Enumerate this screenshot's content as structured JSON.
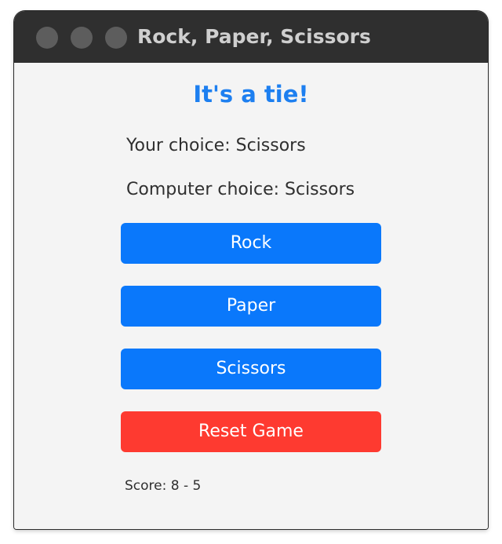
{
  "window": {
    "title": "Rock, Paper, Scissors"
  },
  "game": {
    "result": "It's a tie!",
    "your_choice": "Your choice: Scissors",
    "computer_choice": "Computer choice: Scissors",
    "score": "Score: 8 - 5"
  },
  "buttons": {
    "rock": "Rock",
    "paper": "Paper",
    "scissors": "Scissors",
    "reset": "Reset Game"
  },
  "colors": {
    "accent_blue": "#0a78fb",
    "result_blue": "#1d7ff0",
    "reset_red": "#fe3a30",
    "titlebar": "#2f2f2f",
    "background": "#f4f4f4"
  }
}
